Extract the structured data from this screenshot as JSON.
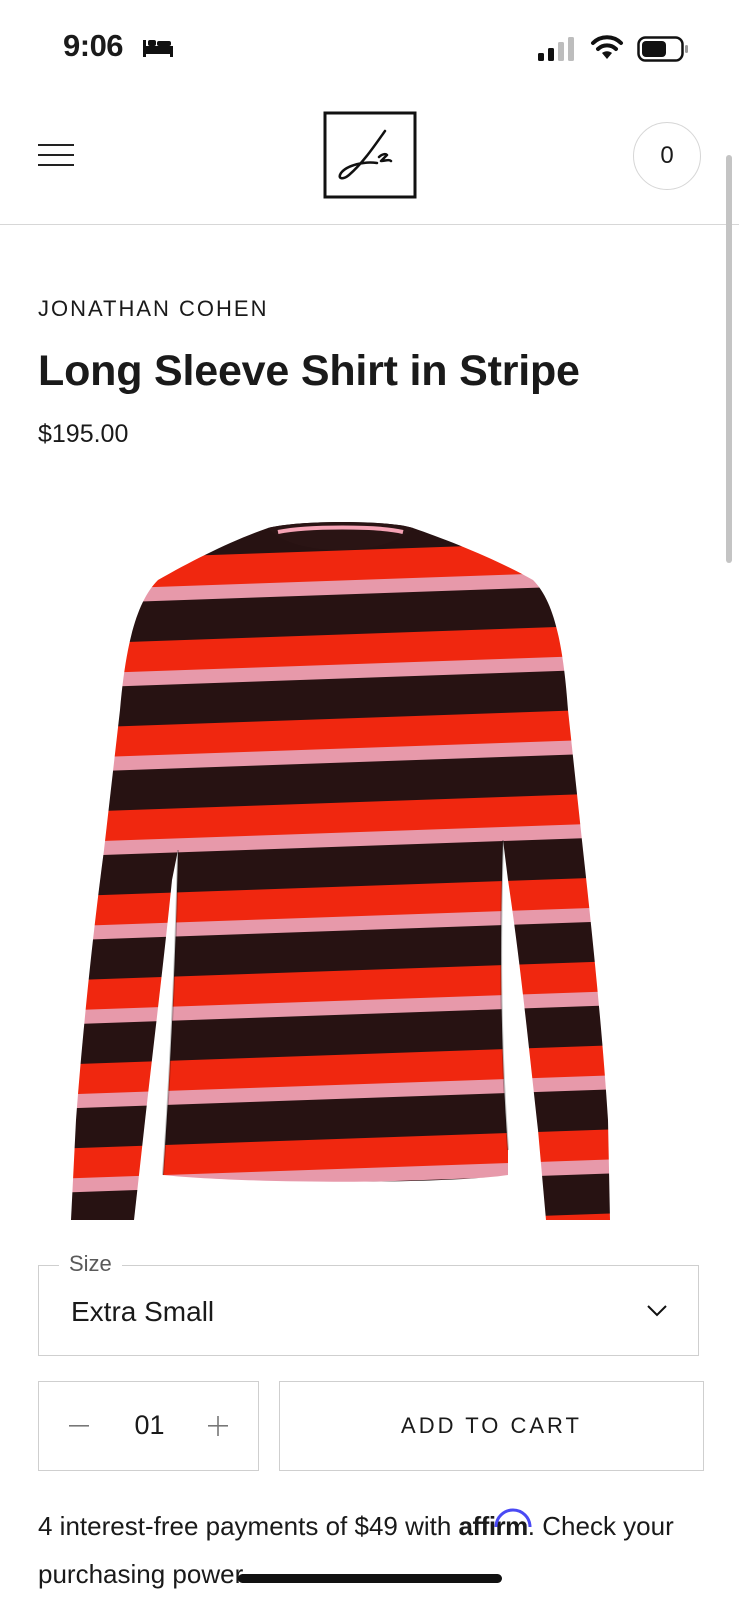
{
  "status_bar": {
    "time": "9:06",
    "icons": [
      "sleep-icon",
      "signal-icon",
      "wifi-icon",
      "battery-icon"
    ]
  },
  "header": {
    "menu_icon": "hamburger-menu-icon",
    "logo": "jonathan-cohen-logo",
    "cart_count": "0"
  },
  "product": {
    "brand": "JONATHAN COHEN",
    "title": "Long Sleeve Shirt in Stripe",
    "price": "$195.00",
    "image": "striped-long-sleeve-shirt",
    "stripe_colors": [
      "#2a1414",
      "#ff2a10",
      "#f6a3b5"
    ]
  },
  "size": {
    "label": "Size",
    "selected": "Extra Small"
  },
  "quantity": {
    "value": "01"
  },
  "buttons": {
    "add_to_cart": "ADD TO CART"
  },
  "financing": {
    "text_before": "4 interest-free payments of $49 with ",
    "brand": "affirm",
    "text_after": ". Check your purchasing power"
  },
  "colors": {
    "text": "#1a1a1a",
    "border": "#cfcfcf",
    "affirm_accent": "#4a4af4"
  }
}
